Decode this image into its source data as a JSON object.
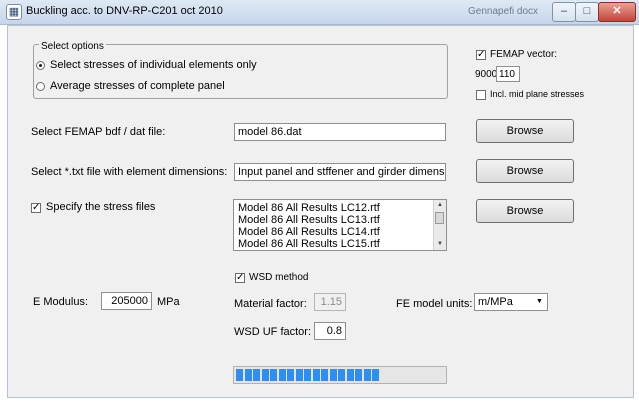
{
  "window": {
    "title": "Buckling acc. to DNV-RP-C201 oct 2010",
    "background_window_text": "Gennapefi docx"
  },
  "options": {
    "group_label": "Select options",
    "radio_individual": "Select stresses of individual elements only",
    "radio_average": "Average stresses of complete panel",
    "selected": "individual"
  },
  "femap_vector": {
    "label": "FEMAP vector:",
    "checked": true,
    "prefix": "9000",
    "value": "110",
    "mid_plane_label": "Incl. mid plane stresses",
    "mid_plane_checked": false
  },
  "files": {
    "bdf_label": "Select FEMAP bdf / dat file:",
    "bdf_value": "model 86.dat",
    "txt_label": "Select *.txt file with element dimensions:",
    "txt_value": "Input panel and stffener and girder dimension",
    "stress_label": "Specify the stress files",
    "stress_checked": true,
    "stress_files": [
      "Model 86 All Results LC12.rtf",
      "Model 86 All Results LC13.rtf",
      "Model 86 All Results LC14.rtf",
      "Model 86 All Results LC15.rtf"
    ],
    "browse_label": "Browse"
  },
  "material": {
    "e_modulus_label": "E Modulus:",
    "e_modulus_value": "205000",
    "e_modulus_unit": "MPa",
    "wsd_label": "WSD method",
    "wsd_checked": true,
    "material_factor_label": "Material factor:",
    "material_factor_value": "1.15",
    "wsd_uf_label": "WSD UF factor:",
    "wsd_uf_value": "0.8",
    "fe_units_label": "FE model units:",
    "fe_units_value": "m/MPa"
  },
  "progress": {
    "fraction": 0.69,
    "segments": 17
  },
  "colors": {
    "progress_segment": "#2e8ff0",
    "titlebar": "#c6d6ea"
  }
}
